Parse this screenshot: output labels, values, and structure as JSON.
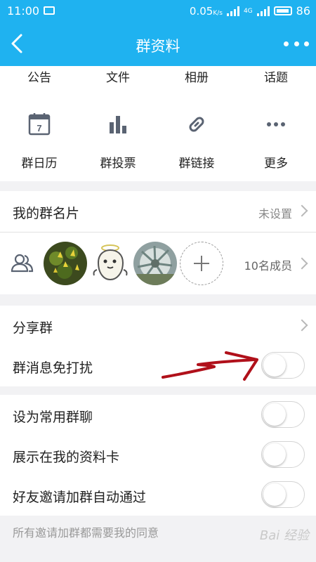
{
  "status_bar": {
    "time": "11:00",
    "speed": "0.05",
    "speed_unit": "K/s",
    "network": "4G",
    "battery": "86"
  },
  "nav": {
    "title": "群资料"
  },
  "top_tabs": [
    "公告",
    "文件",
    "相册",
    "话题"
  ],
  "tools": [
    {
      "label": "群日历",
      "icon": "calendar-icon",
      "calendar_day": "7"
    },
    {
      "label": "群投票",
      "icon": "bar-chart-icon"
    },
    {
      "label": "群链接",
      "icon": "link-icon"
    },
    {
      "label": "更多",
      "icon": "more-dots-icon"
    }
  ],
  "group_card": {
    "label": "我的群名片",
    "value": "未设置"
  },
  "members": {
    "count_label": "10名成员",
    "icon": "members-icon",
    "add_icon": "plus-icon"
  },
  "settings": [
    {
      "label": "分享群",
      "type": "link"
    },
    {
      "label": "群消息免打扰",
      "type": "toggle",
      "on": false
    },
    {
      "label": "设为常用群聊",
      "type": "toggle",
      "on": false
    },
    {
      "label": "展示在我的资料卡",
      "type": "toggle",
      "on": false
    },
    {
      "label": "好友邀请加群自动通过",
      "type": "toggle",
      "on": false
    }
  ],
  "footnote": "所有邀请加群都需要我的同意",
  "watermark": "Bai 经验",
  "colors": {
    "brand_blue": "#1fb2f0",
    "annotation_red": "#b0101a"
  }
}
